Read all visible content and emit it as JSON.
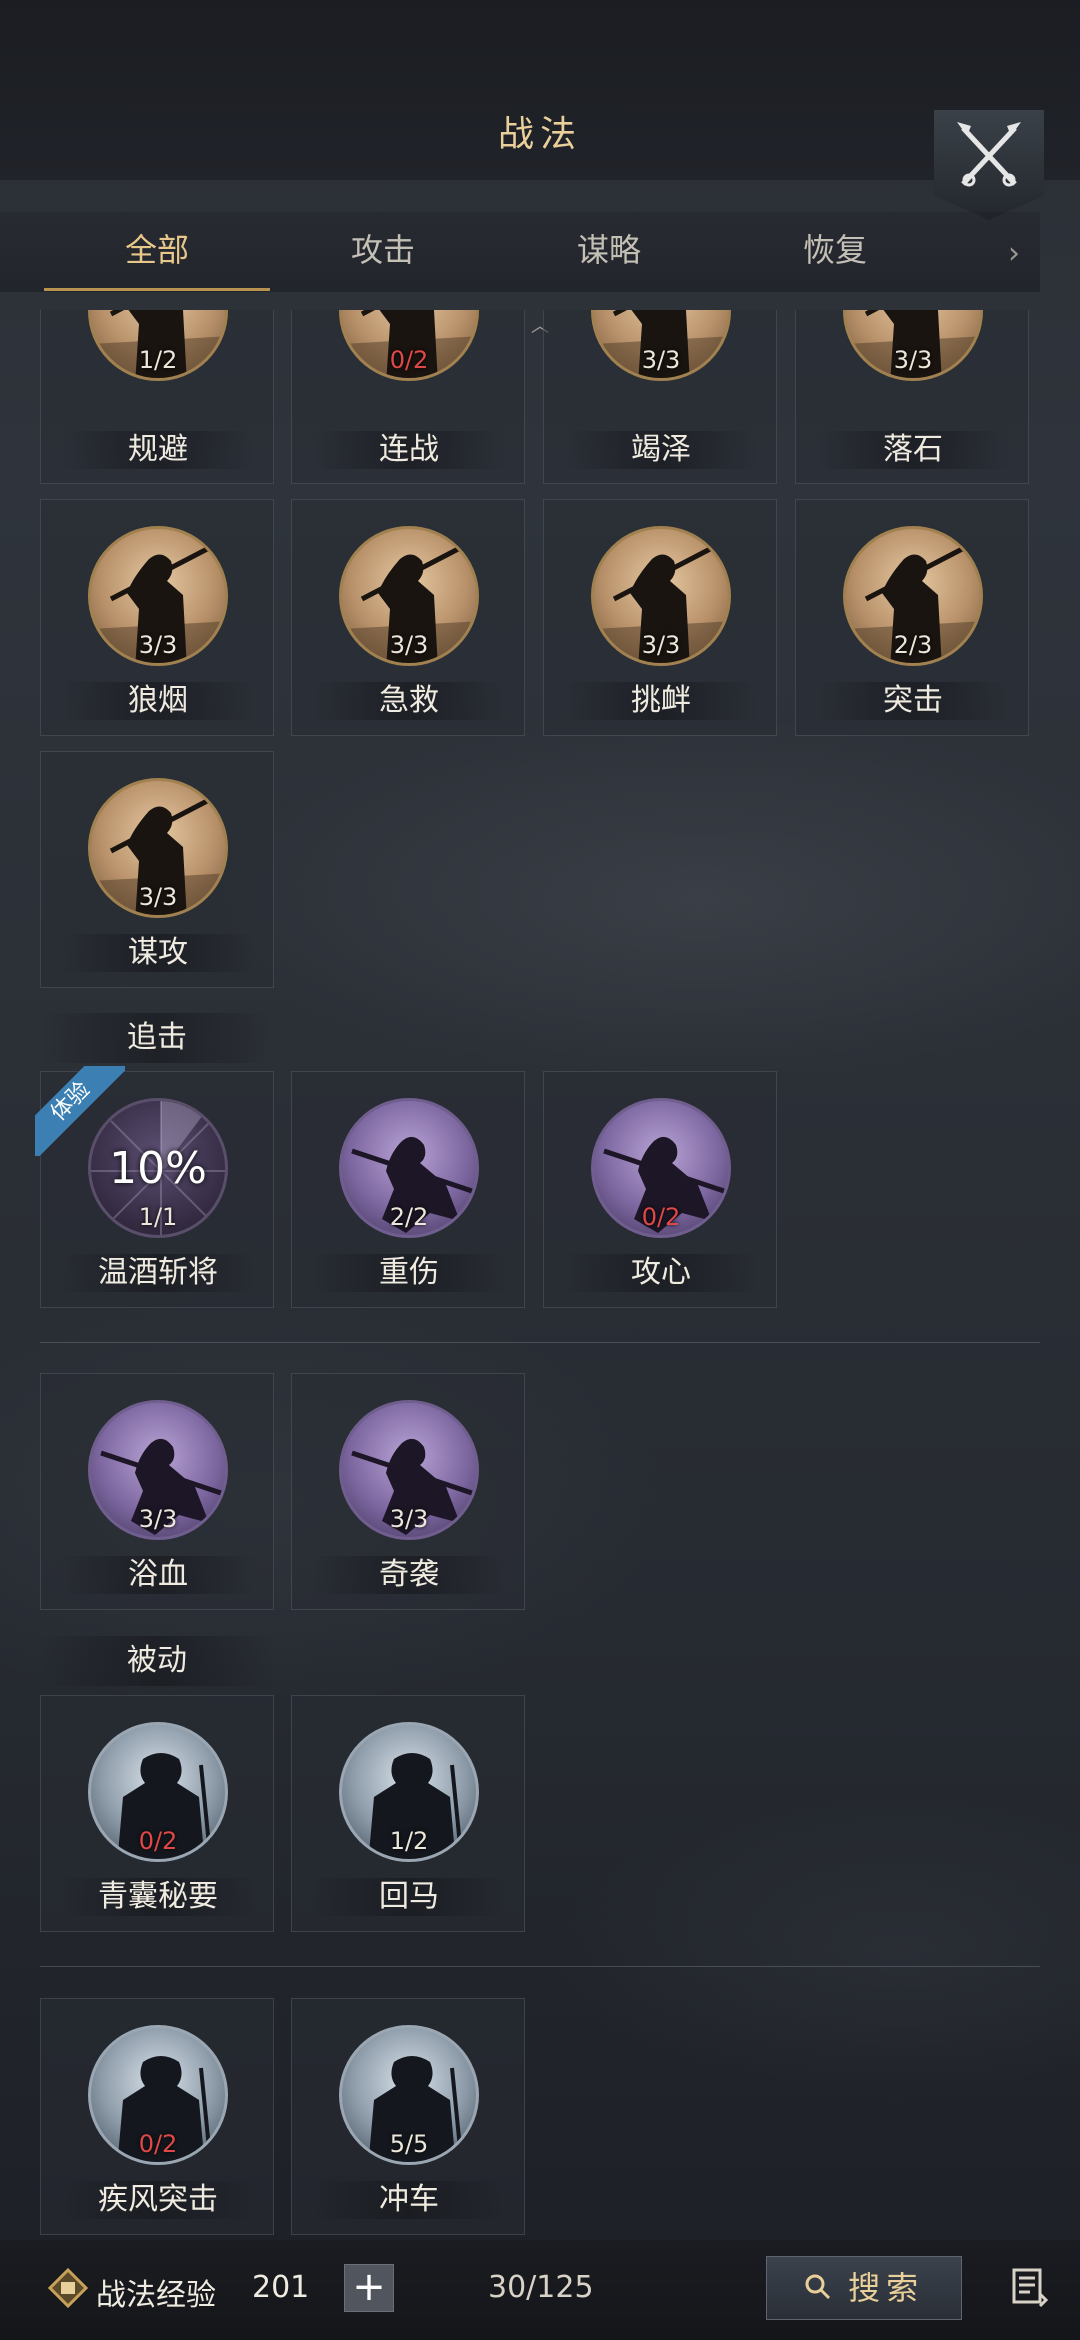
{
  "header": {
    "title": "战法"
  },
  "tabs": [
    {
      "label": "全部",
      "active": true
    },
    {
      "label": "攻击",
      "active": false
    },
    {
      "label": "谋略",
      "active": false
    },
    {
      "label": "恢复",
      "active": false
    }
  ],
  "skills": {
    "s0": {
      "name": "规避",
      "level": "1/2"
    },
    "s1": {
      "name": "连战",
      "level": "0/2"
    },
    "s2": {
      "name": "竭泽",
      "level": "3/3"
    },
    "s3": {
      "name": "落石",
      "level": "3/3"
    },
    "s4": {
      "name": "狼烟",
      "level": "3/3"
    },
    "s5": {
      "name": "急救",
      "level": "3/3"
    },
    "s6": {
      "name": "挑衅",
      "level": "3/3"
    },
    "s7": {
      "name": "突击",
      "level": "2/3"
    },
    "s8": {
      "name": "谋攻",
      "level": "3/3"
    },
    "p0": {
      "name": "温酒斩将",
      "level": "1/1",
      "badge": "体验",
      "percent": "10%"
    },
    "p1": {
      "name": "重伤",
      "level": "2/2"
    },
    "p2": {
      "name": "攻心",
      "level": "0/2"
    },
    "p3": {
      "name": "浴血",
      "level": "3/3"
    },
    "p4": {
      "name": "奇袭",
      "level": "3/3"
    },
    "b0": {
      "name": "青囊秘要",
      "level": "0/2"
    },
    "b1": {
      "name": "回马",
      "level": "1/2"
    },
    "b2": {
      "name": "疾风突击",
      "level": "0/2"
    },
    "b3": {
      "name": "冲车",
      "level": "5/5"
    }
  },
  "sections": {
    "pursuit": "追击",
    "passive": "被动"
  },
  "footer": {
    "exp_label": "战法经验",
    "exp_value": "201",
    "plus": "+",
    "count": "30/125",
    "search_label": "搜索"
  },
  "colors": {
    "accent": "#e9cf9a",
    "level_red": "#e04848",
    "trial_blue": "#3c7fb3"
  }
}
